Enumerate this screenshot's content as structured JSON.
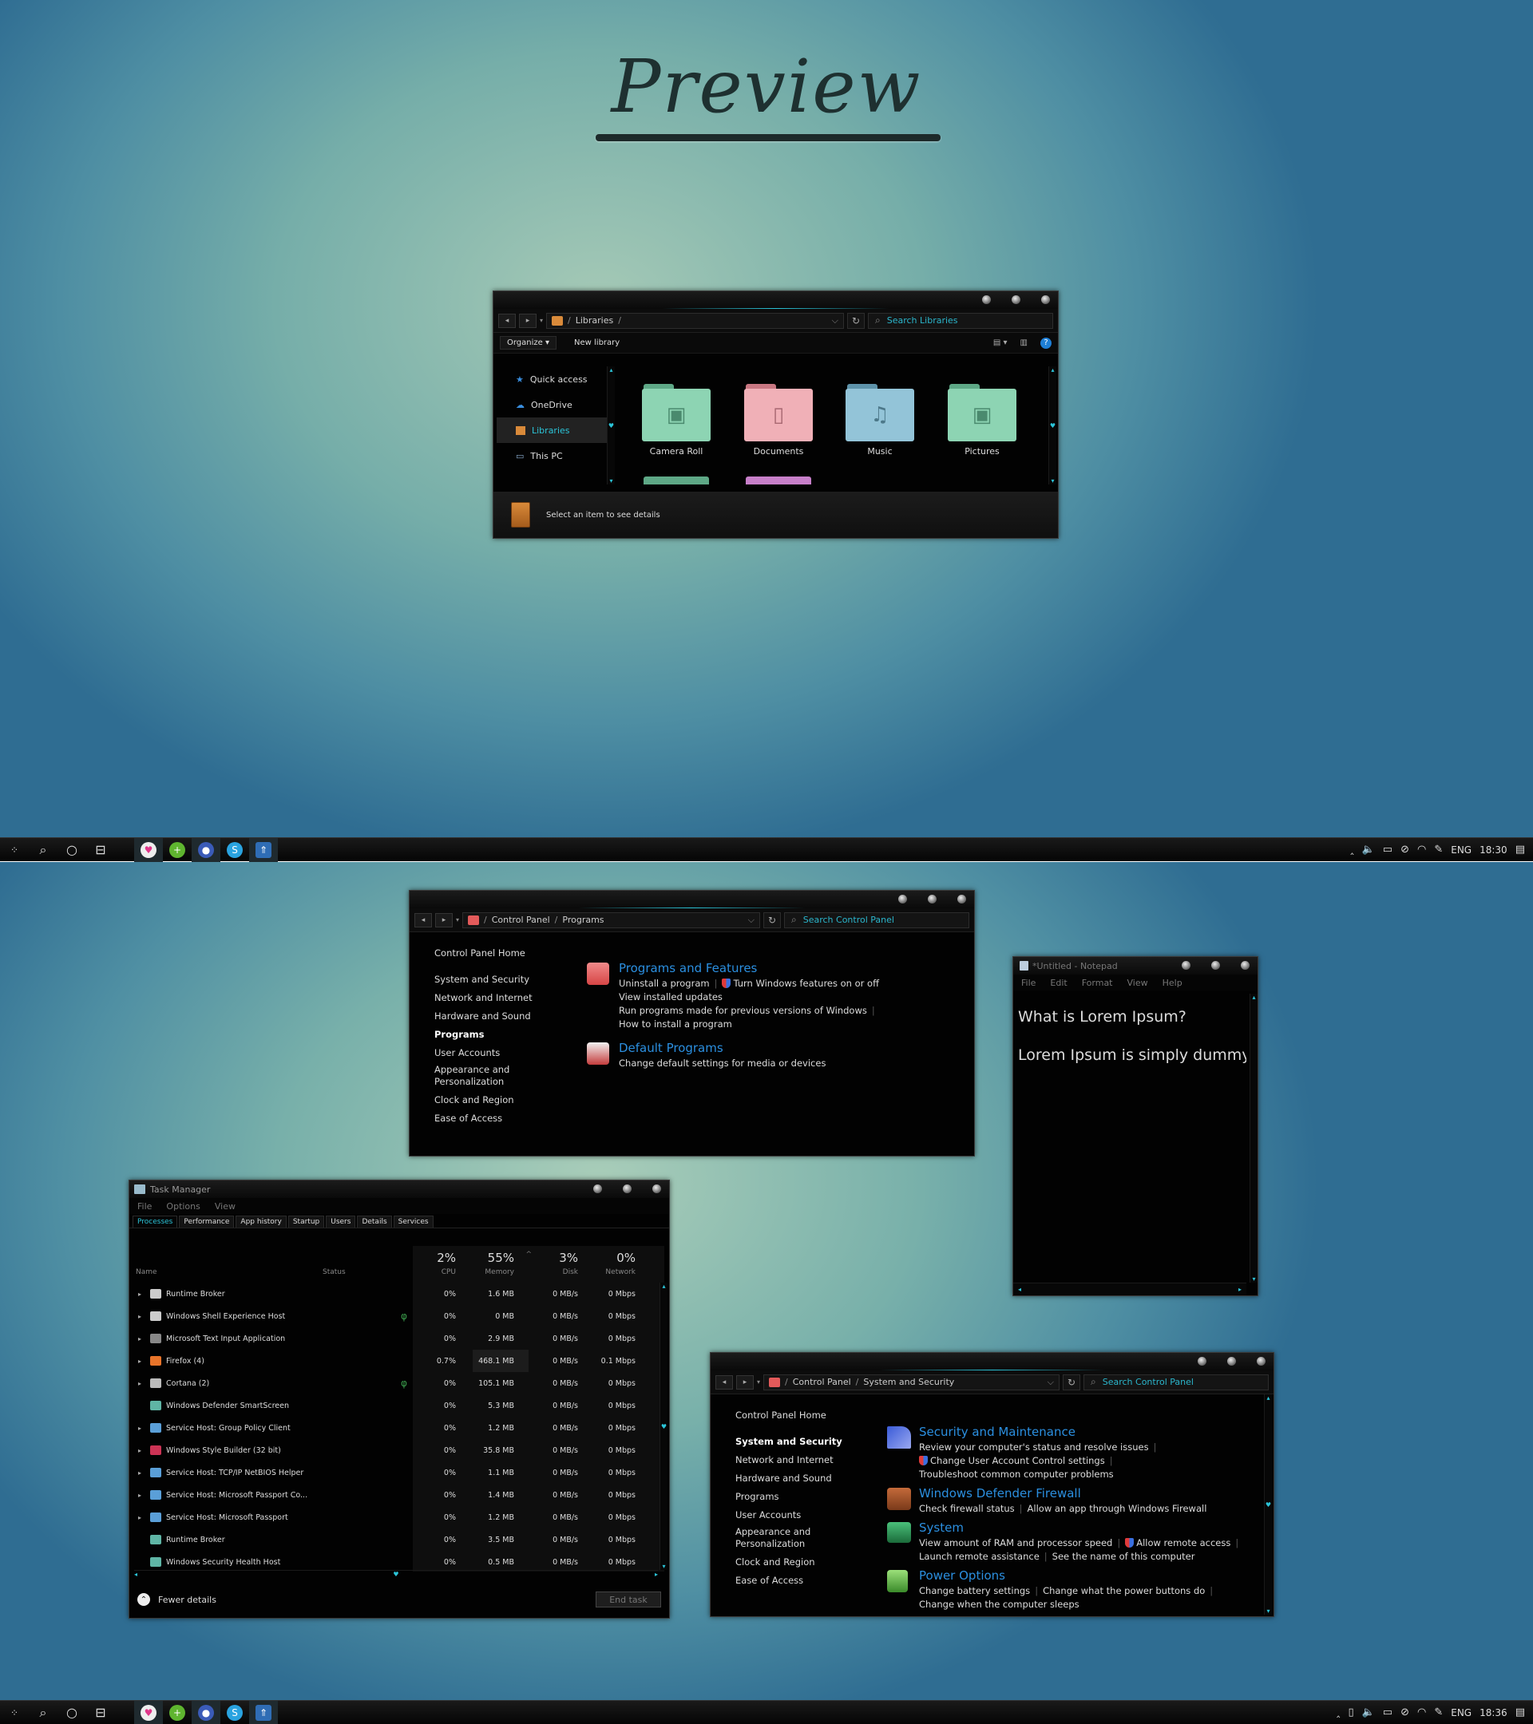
{
  "header": {
    "title": "Preview"
  },
  "taskbar1": {
    "lang": "ENG",
    "time": "18:30"
  },
  "taskbar2": {
    "lang": "ENG",
    "time": "18:36"
  },
  "explorer": {
    "breadcrumb": [
      "Libraries"
    ],
    "search_placeholder": "Search Libraries",
    "organize": "Organize",
    "new_library": "New library",
    "nav": [
      {
        "label": "Quick access",
        "icon": "star-icon"
      },
      {
        "label": "OneDrive",
        "icon": "cloud-icon"
      },
      {
        "label": "Libraries",
        "icon": "library-icon"
      },
      {
        "label": "This PC",
        "icon": "computer-icon"
      }
    ],
    "folders": [
      {
        "label": "Camera Roll",
        "color": "#7fc7a6",
        "glyph": "🖼"
      },
      {
        "label": "Documents",
        "color": "#e79aa3",
        "glyph": "🗋"
      },
      {
        "label": "Music",
        "color": "#7fb4c9",
        "glyph": "♫"
      },
      {
        "label": "Pictures",
        "color": "#7fc7a6",
        "glyph": "🖼"
      }
    ],
    "details_text": "Select an item to see details"
  },
  "cp_programs": {
    "breadcrumb": [
      "Control Panel",
      "Programs"
    ],
    "search_placeholder": "Search Control Panel",
    "side": [
      "Control Panel Home",
      "System and Security",
      "Network and Internet",
      "Hardware and Sound",
      "Programs",
      "User Accounts",
      "Appearance and",
      "Personalization",
      "Clock and Region",
      "Ease of Access"
    ],
    "sections": [
      {
        "title": "Programs and Features",
        "links": [
          "Uninstall a program",
          "Turn Windows features on or off",
          "View installed updates",
          "Run programs made for previous versions of Windows",
          "How to install a program"
        ]
      },
      {
        "title": "Default Programs",
        "links": [
          "Change default settings for media or devices"
        ]
      }
    ]
  },
  "notepad": {
    "title": "*Untitled - Notepad",
    "menu": [
      "File",
      "Edit",
      "Format",
      "View",
      "Help"
    ],
    "lines": [
      "What is Lorem Ipsum?",
      "Lorem Ipsum is simply dummy"
    ]
  },
  "taskmgr": {
    "title": "Task Manager",
    "menu": [
      "File",
      "Options",
      "View"
    ],
    "tabs": [
      "Processes",
      "Performance",
      "App history",
      "Startup",
      "Users",
      "Details",
      "Services"
    ],
    "headers": {
      "name": "Name",
      "status": "Status",
      "cpu_pct": "2%",
      "cpu": "CPU",
      "mem_pct": "55%",
      "mem": "Memory",
      "disk_pct": "3%",
      "disk": "Disk",
      "net_pct": "0%",
      "net": "Network"
    },
    "rows": [
      {
        "name": "Runtime Broker",
        "cpu": "0%",
        "mem": "1.6 MB",
        "disk": "0 MB/s",
        "net": "0 Mbps"
      },
      {
        "name": "Windows Shell Experience Host",
        "cpu": "0%",
        "mem": "0 MB",
        "disk": "0 MB/s",
        "net": "0 Mbps"
      },
      {
        "name": "Microsoft Text Input Application",
        "cpu": "0%",
        "mem": "2.9 MB",
        "disk": "0 MB/s",
        "net": "0 Mbps"
      },
      {
        "name": "Firefox (4)",
        "cpu": "0.7%",
        "mem": "468.1 MB",
        "disk": "0 MB/s",
        "net": "0.1 Mbps"
      },
      {
        "name": "Cortana (2)",
        "cpu": "0%",
        "mem": "105.1 MB",
        "disk": "0 MB/s",
        "net": "0 Mbps"
      },
      {
        "name": "Windows Defender SmartScreen",
        "cpu": "0%",
        "mem": "5.3 MB",
        "disk": "0 MB/s",
        "net": "0 Mbps"
      },
      {
        "name": "Service Host: Group Policy Client",
        "cpu": "0%",
        "mem": "1.2 MB",
        "disk": "0 MB/s",
        "net": "0 Mbps"
      },
      {
        "name": "Windows Style Builder (32 bit)",
        "cpu": "0%",
        "mem": "35.8 MB",
        "disk": "0 MB/s",
        "net": "0 Mbps"
      },
      {
        "name": "Service Host: TCP/IP NetBIOS Helper",
        "cpu": "0%",
        "mem": "1.1 MB",
        "disk": "0 MB/s",
        "net": "0 Mbps"
      },
      {
        "name": "Service Host: Microsoft Passport Co...",
        "cpu": "0%",
        "mem": "1.4 MB",
        "disk": "0 MB/s",
        "net": "0 Mbps"
      },
      {
        "name": "Service Host: Microsoft Passport",
        "cpu": "0%",
        "mem": "1.2 MB",
        "disk": "0 MB/s",
        "net": "0 Mbps"
      },
      {
        "name": "Runtime Broker",
        "cpu": "0%",
        "mem": "3.5 MB",
        "disk": "0 MB/s",
        "net": "0 Mbps"
      },
      {
        "name": "Windows Security Health Host",
        "cpu": "0%",
        "mem": "0.5 MB",
        "disk": "0 MB/s",
        "net": "0 Mbps"
      }
    ],
    "fewer": "Fewer details",
    "end_task": "End task"
  },
  "cp_security": {
    "breadcrumb": [
      "Control Panel",
      "System and Security"
    ],
    "search_placeholder": "Search Control Panel",
    "side": [
      "Control Panel Home",
      "System and Security",
      "Network and Internet",
      "Hardware and Sound",
      "Programs",
      "User Accounts",
      "Appearance and",
      "Personalization",
      "Clock and Region",
      "Ease of Access"
    ],
    "sections": [
      {
        "title": "Security and Maintenance",
        "l1": "Review your computer's status and resolve issues",
        "l2": "Change User Account Control settings",
        "l3": "Troubleshoot common computer problems"
      },
      {
        "title": "Windows Defender Firewall",
        "l1": "Check firewall status",
        "l2": "Allow an app through Windows Firewall"
      },
      {
        "title": "System",
        "l1": "View amount of RAM and processor speed",
        "l2": "Allow remote access",
        "l3": "Launch remote assistance",
        "l4": "See the name of this computer"
      },
      {
        "title": "Power Options",
        "l1": "Change battery settings",
        "l2": "Change what the power buttons do",
        "l3": "Change when the computer sleeps"
      }
    ]
  }
}
